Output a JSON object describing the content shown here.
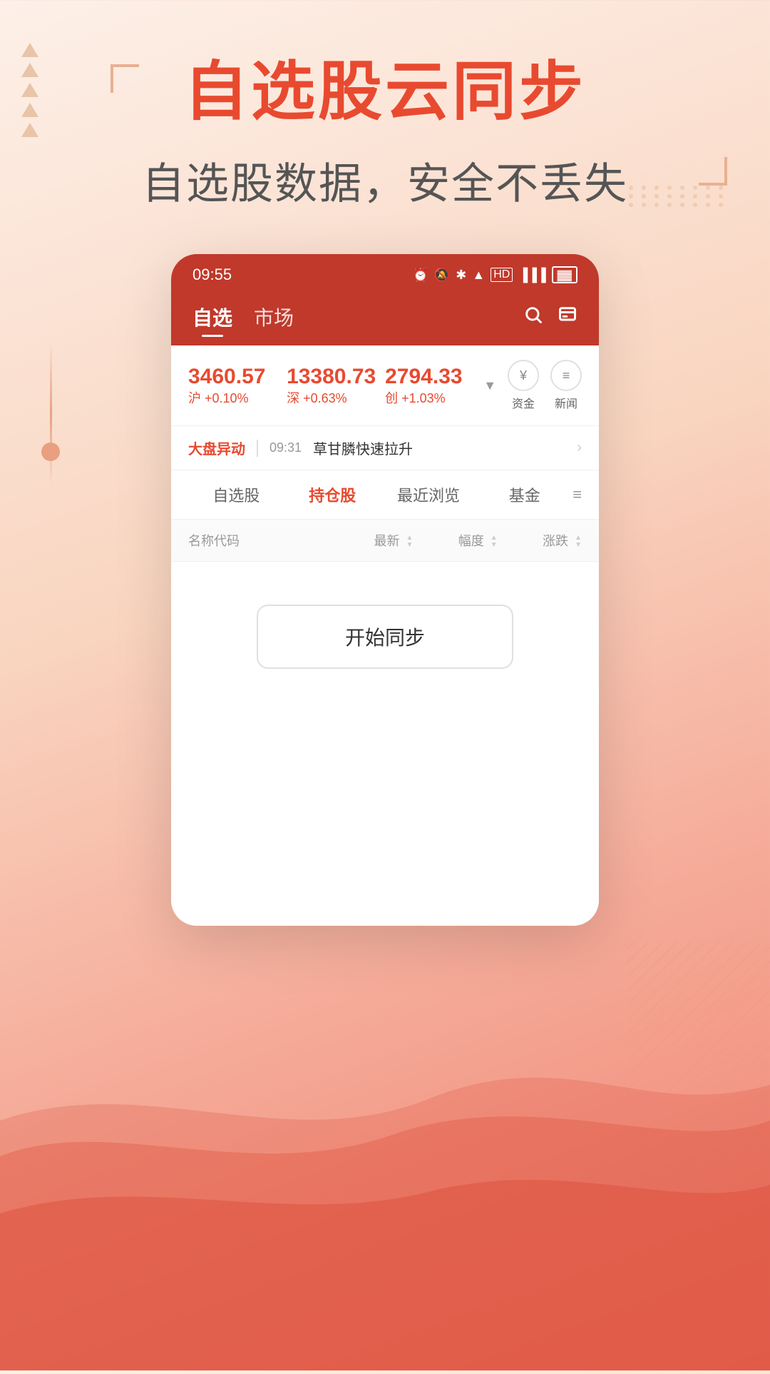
{
  "page": {
    "background_color_top": "#fdf0e8",
    "background_color_mid": "#f9d5c0",
    "background_color_bottom": "#f08070"
  },
  "hero": {
    "main_title": "自选股云同步",
    "sub_title": "自选股数据，安全不丢失"
  },
  "status_bar": {
    "time": "09:55",
    "icons": [
      "⏰",
      "🔕",
      "✱",
      "WiFi",
      "HD",
      "5G",
      "🔋"
    ]
  },
  "app_header": {
    "nav_tabs": [
      {
        "label": "自选",
        "active": true
      },
      {
        "label": "市场",
        "active": false
      }
    ],
    "search_icon": "search",
    "menu_icon": "menu"
  },
  "market_data": {
    "indexes": [
      {
        "value": "3460.57",
        "label": "沪 +0.10%"
      },
      {
        "value": "13380.73",
        "label": "深 +0.63%"
      },
      {
        "value": "2794.33",
        "label": "创 +1.03%"
      }
    ],
    "actions": [
      {
        "icon": "¥",
        "label": "资金"
      },
      {
        "icon": "≡",
        "label": "新闻"
      }
    ]
  },
  "news_ticker": {
    "tag": "大盘异动",
    "time": "09:31",
    "text": "草甘膦快速拉升"
  },
  "stock_tabs": [
    {
      "label": "自选股",
      "active": false
    },
    {
      "label": "持仓股",
      "active": true
    },
    {
      "label": "最近浏览",
      "active": false
    },
    {
      "label": "基金",
      "active": false
    }
  ],
  "table_header": {
    "col_name": "名称代码",
    "col_latest": "最新",
    "col_change": "幅度",
    "col_rise": "涨跌"
  },
  "sync_button": {
    "label": "开始同步"
  }
}
